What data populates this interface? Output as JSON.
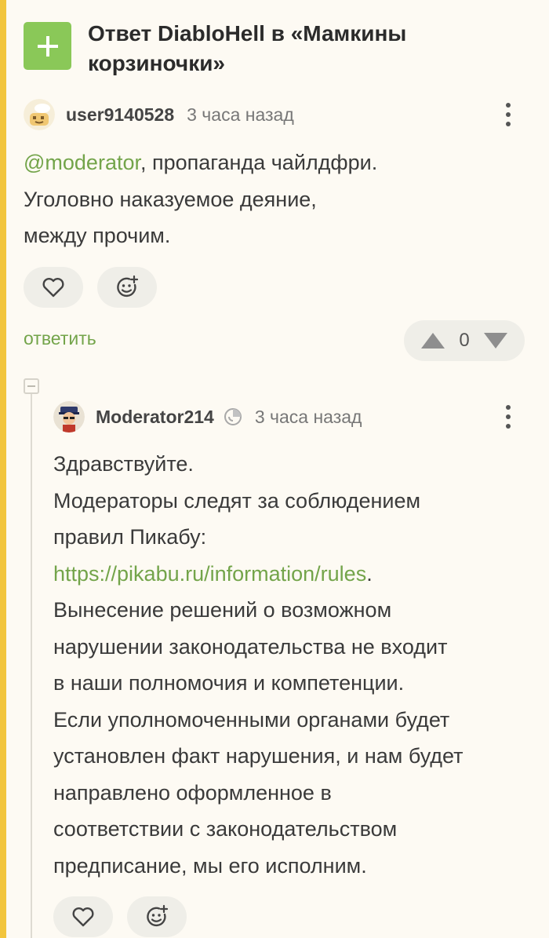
{
  "header": {
    "title": "Ответ DiabloHell в «Мамкины корзиночки»",
    "add_icon": "plus-icon",
    "accent_color": "#8ac858"
  },
  "comment1": {
    "username": "user9140528",
    "time": "3 часа назад",
    "mention": "@moderator",
    "text_after_mention": ", пропаганда чайлдфри.",
    "line2": "Уголовно наказуемое деяние,",
    "line3": "между прочим.",
    "reply_label": "ответить",
    "score": "0"
  },
  "comment2": {
    "username": "Moderator214",
    "time": "3 часа назад",
    "line1": "Здравствуйте.",
    "line2": "Модераторы следят за соблюдением",
    "line3": "правил Пикабу:",
    "link": "https://pikabu.ru/information/rules",
    "link_suffix": ".",
    "line5": "Вынесение решений о возможном",
    "line6": "нарушении законодательства не входит",
    "line7": "в наши полномочия и компетенции.",
    "line8": "Если уполномоченными органами будет",
    "line9": "установлен факт нарушения, и нам будет",
    "line10": "направлено оформленное в",
    "line11": "соответствии с законодательством",
    "line12": "предписание, мы его исполним."
  },
  "colors": {
    "link": "#73a44a",
    "stripe": "#f2c53d",
    "background": "#fdfaf3"
  }
}
